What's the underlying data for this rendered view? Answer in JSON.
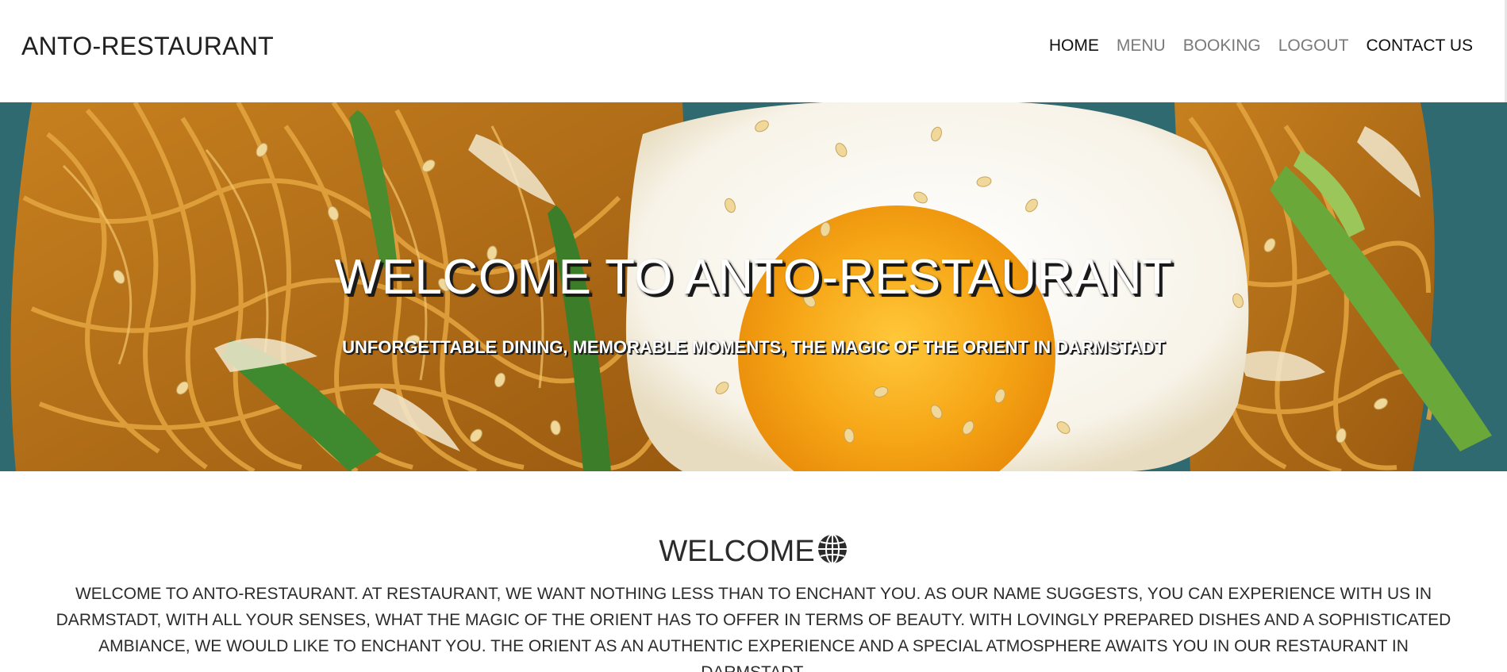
{
  "brand": {
    "name": "ANTO-RESTAURANT"
  },
  "nav": {
    "items": [
      {
        "label": "HOME"
      },
      {
        "label": "MENU"
      },
      {
        "label": "BOOKING"
      },
      {
        "label": "LOGOUT"
      },
      {
        "label": "CONTACT US"
      }
    ]
  },
  "hero": {
    "title": "WELCOME TO ANTO-RESTAURANT",
    "subtitle": "UNFORGETTABLE DINING, MEMORABLE MOMENTS, THE MAGIC OF THE ORIENT IN DARMSTADT",
    "image_icon": "noodles-with-fried-egg-photo"
  },
  "welcome": {
    "heading": "WELCOME",
    "heading_icon": "globe-icon",
    "text": "WELCOME TO ANTO-RESTAURANT. AT RESTAURANT, WE WANT NOTHING LESS THAN TO ENCHANT YOU. AS OUR NAME SUGGESTS, YOU CAN EXPERIENCE WITH US IN DARMSTADT, WITH ALL YOUR SENSES, WHAT THE MAGIC OF THE ORIENT HAS TO OFFER IN TERMS OF BEAUTY. WITH LOVINGLY PREPARED DISHES AND A SOPHISTICATED AMBIANCE, WE WOULD LIKE TO ENCHANT YOU. THE ORIENT AS AN AUTHENTIC EXPERIENCE AND A SPECIAL ATMOSPHERE AWAITS YOU IN OUR RESTAURANT IN DARMSTADT."
  },
  "colors": {
    "nav_active": "#111111",
    "nav_inactive": "#7a7a7a",
    "text": "#2b2b2b",
    "hero_plate": "#2f6b72",
    "egg_yolk": "#f4a30f"
  }
}
